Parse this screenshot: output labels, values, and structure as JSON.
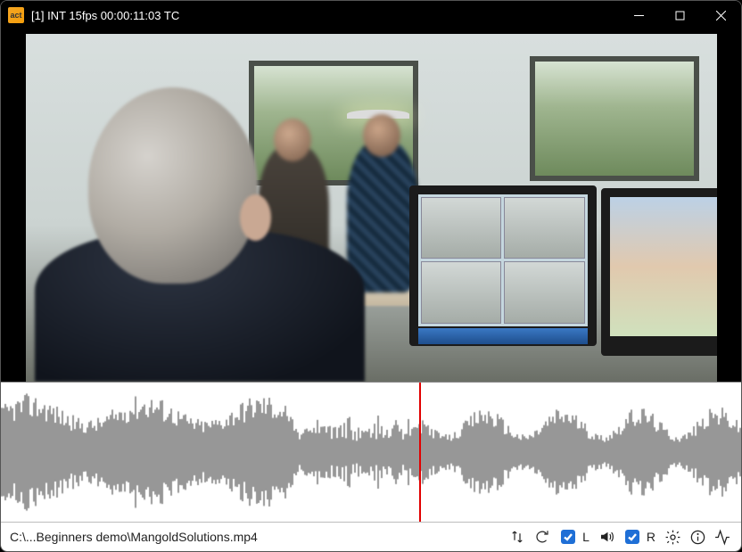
{
  "titlebar": {
    "app_icon_label": "act",
    "title": "[1] INT 15fps  00:00:11:03 TC"
  },
  "video": {
    "playhead_ratio": 0.565
  },
  "statusbar": {
    "filepath": "C:\\...Beginners demo\\MangoldSolutions.mp4",
    "channel_left_label": "L",
    "channel_left_checked": true,
    "channel_right_label": "R",
    "channel_right_checked": true
  },
  "icons": {
    "sort": "sort-icon",
    "loop": "loop-icon",
    "speaker": "speaker-icon",
    "gear": "gear-icon",
    "info": "info-icon",
    "activity": "activity-icon"
  }
}
